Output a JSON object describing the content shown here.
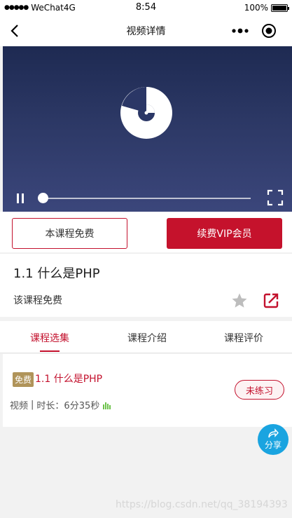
{
  "status_bar": {
    "signal": "●●●●●",
    "carrier": "WeChat4G",
    "time": "8:54",
    "battery": "100%"
  },
  "nav": {
    "title": "视频详情",
    "icons": [
      "back-icon",
      "more-icon",
      "target-icon"
    ]
  },
  "video": {
    "progress": 0,
    "icons": [
      "pause-icon",
      "fullscreen-icon",
      "loading-spinner-icon"
    ]
  },
  "actions": {
    "free_label": "本课程免费",
    "vip_label": "续费VIP会员"
  },
  "course": {
    "title": "1.1 什么是PHP",
    "price_text": "该课程免费",
    "icons": [
      "star-icon",
      "share-out-icon"
    ]
  },
  "tabs": [
    {
      "label": "课程选集",
      "active": true
    },
    {
      "label": "课程介绍",
      "active": false
    },
    {
      "label": "课程评价",
      "active": false
    }
  ],
  "lesson": {
    "badge": "免费",
    "name": "1.1 什么是PHP",
    "type": "视频",
    "separator": "|",
    "duration_label": "时长：",
    "duration": "6分35秒",
    "practice_label": "未练习"
  },
  "share_fab": {
    "label": "分享"
  },
  "watermark": "https://blog.csdn.net/qq_38194393",
  "colors": {
    "accent": "#c3112d",
    "badge": "#b0945a",
    "fab": "#1aa4e0",
    "video_top": "#1e2a52",
    "video_bottom": "#3b467b"
  }
}
